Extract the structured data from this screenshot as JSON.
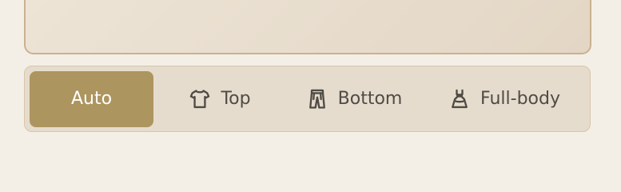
{
  "segments": {
    "active": "Auto",
    "items": [
      {
        "label": "Auto",
        "icon": ""
      },
      {
        "label": "Top",
        "icon": "tshirt-icon"
      },
      {
        "label": "Bottom",
        "icon": "pants-icon"
      },
      {
        "label": "Full-body",
        "icon": "dress-icon"
      }
    ]
  },
  "colors": {
    "background": "#f4efe6",
    "panel_border": "#c9b28e",
    "segmented_background": "#e6dccd",
    "active_segment": "#ac955f",
    "text": "#4f4b45"
  }
}
